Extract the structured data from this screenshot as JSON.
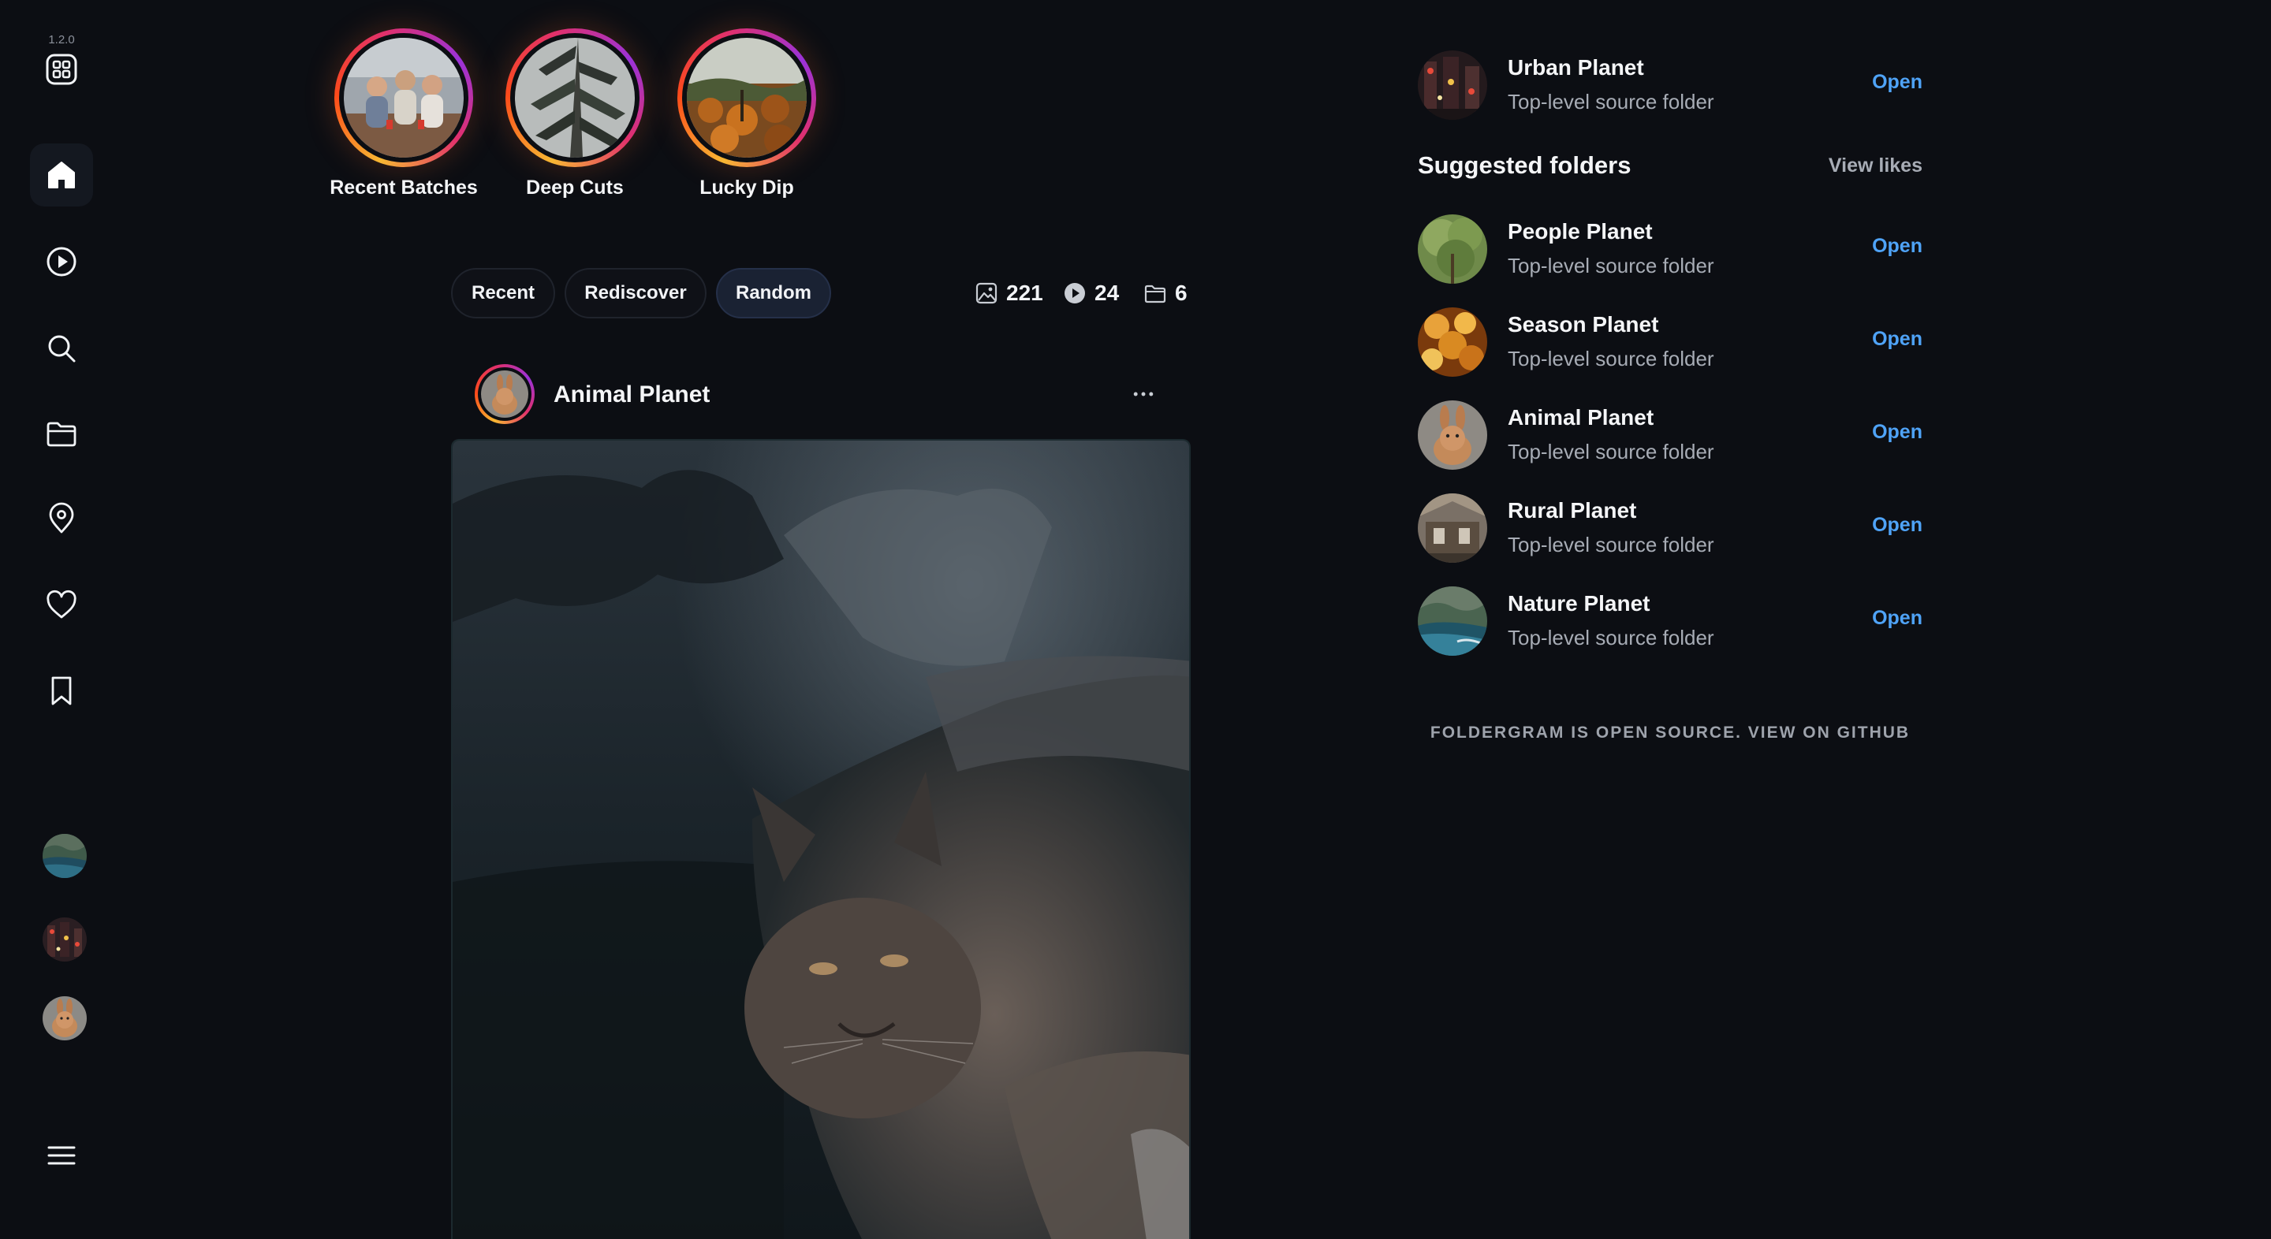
{
  "app": {
    "version": "1.2.0"
  },
  "nav": {
    "items": [
      {
        "id": "home",
        "icon": "home-icon",
        "active": true
      },
      {
        "id": "videos",
        "icon": "play-circle-icon"
      },
      {
        "id": "search",
        "icon": "search-icon"
      },
      {
        "id": "folders",
        "icon": "folder-icon"
      },
      {
        "id": "places",
        "icon": "map-pin-icon"
      },
      {
        "id": "likes",
        "icon": "heart-icon"
      },
      {
        "id": "saved",
        "icon": "bookmark-icon"
      }
    ],
    "menu_icon": "hamburger-menu-icon"
  },
  "stories": [
    {
      "label": "Recent Batches"
    },
    {
      "label": "Deep Cuts"
    },
    {
      "label": "Lucky Dip"
    }
  ],
  "filters": {
    "tabs": [
      {
        "label": "Recent",
        "active": false
      },
      {
        "label": "Rediscover",
        "active": false
      },
      {
        "label": "Random",
        "active": true
      }
    ],
    "stats": {
      "photos": "221",
      "videos": "24",
      "folders": "6"
    }
  },
  "post": {
    "folder_name": "Animal Planet",
    "more_icon": "more-horizontal-icon"
  },
  "sidebar_right": {
    "current": {
      "name": "Urban Planet",
      "subtitle": "Top-level source folder",
      "action": "Open"
    },
    "suggested_title": "Suggested folders",
    "view_likes": "View likes",
    "suggestions": [
      {
        "name": "People Planet",
        "subtitle": "Top-level source folder",
        "action": "Open"
      },
      {
        "name": "Season Planet",
        "subtitle": "Top-level source folder",
        "action": "Open"
      },
      {
        "name": "Animal Planet",
        "subtitle": "Top-level source folder",
        "action": "Open"
      },
      {
        "name": "Rural Planet",
        "subtitle": "Top-level source folder",
        "action": "Open"
      },
      {
        "name": "Nature Planet",
        "subtitle": "Top-level source folder",
        "action": "Open"
      }
    ],
    "footer": "FOLDERGRAM IS OPEN SOURCE. VIEW ON GITHUB"
  },
  "colors": {
    "background": "#0c0e13",
    "accent_link": "#4fa3f7",
    "chip_active": "#1a2233",
    "ring_gradient": [
      "#f7b733",
      "#fc4a1a",
      "#e1306c",
      "#9b32d8"
    ]
  }
}
